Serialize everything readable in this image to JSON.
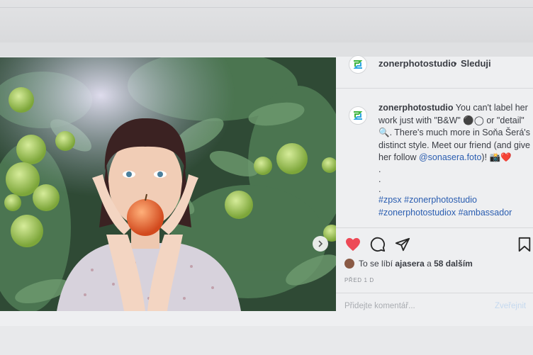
{
  "account": {
    "username": "zonerphotostudio",
    "follow_label": "Sleduji",
    "separator": "•"
  },
  "caption": {
    "username": "zonerphotostudio",
    "text_1": "You can't label her work just with \"B&W\" ⚫◯ or \"detail\" 🔍. There's much more in Soňa Šerá's distinct style. Meet our friend (and give her follow",
    "mention": "@sonasera.foto",
    "text_2": ")! 📸❤️",
    "dots": [
      ".",
      ".",
      "."
    ],
    "hashtags": "#zpsx #zonerphotostudio #zonerphotostudiox #ambassador"
  },
  "likes": {
    "prefix": "To se líbí",
    "user": "ajasera",
    "middle": "a",
    "count_text": "58 dalším"
  },
  "timestamp": "PŘED 1 D",
  "comment": {
    "placeholder": "Přidejte komentář...",
    "publish_label": "Zveřejnit"
  },
  "colors": {
    "accent_green": "#3cb33c",
    "accent_blue": "#2fa6e0",
    "like_red": "#ed4956",
    "link_blue": "#2a5db0"
  },
  "icons": {
    "like": "heart-icon",
    "comment": "comment-bubble-icon",
    "share": "paper-plane-icon",
    "save": "bookmark-icon",
    "next": "chevron-right-icon"
  },
  "carousel": {
    "slides": 3,
    "active_slide": 1
  }
}
